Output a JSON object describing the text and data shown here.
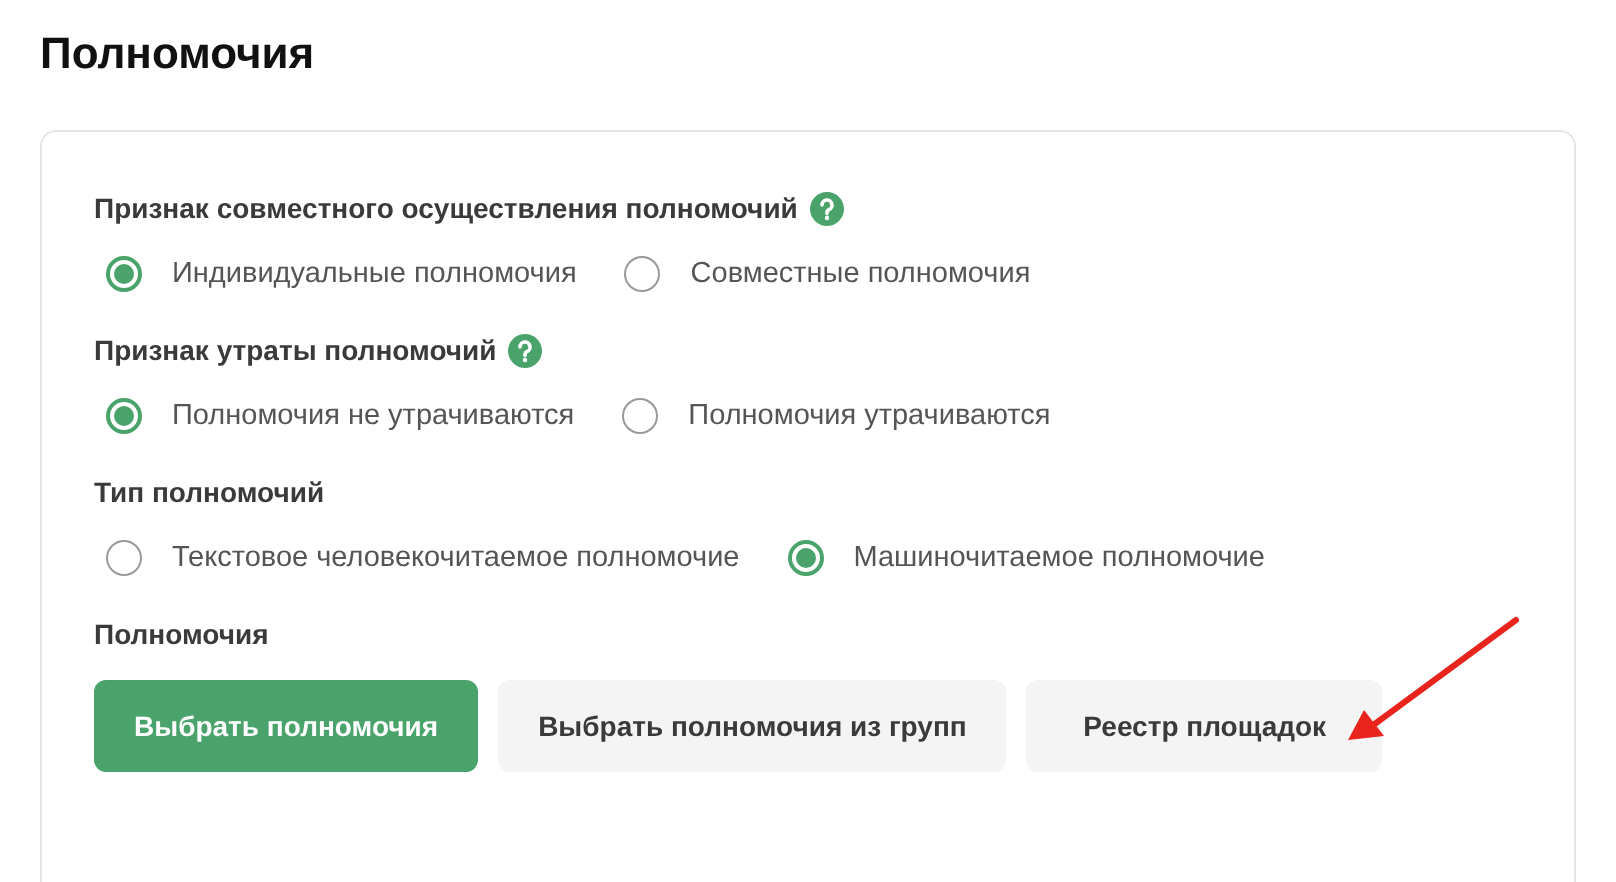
{
  "title": "Полномочия",
  "groups": [
    {
      "label": "Признак совместного осуществления полномочий",
      "help": true,
      "options": [
        {
          "label": "Индивидуальные полномочия",
          "selected": true
        },
        {
          "label": "Совместные полномочия",
          "selected": false
        }
      ]
    },
    {
      "label": "Признак утраты полномочий",
      "help": true,
      "options": [
        {
          "label": "Полномочия не утрачиваются",
          "selected": true
        },
        {
          "label": "Полномочия утрачиваются",
          "selected": false
        }
      ]
    },
    {
      "label": "Тип полномочий",
      "help": false,
      "options": [
        {
          "label": "Текстовое человекочитаемое полномочие",
          "selected": false
        },
        {
          "label": "Машиночитаемое полномочие",
          "selected": true
        }
      ]
    }
  ],
  "actions": {
    "label": "Полномочия",
    "buttons": [
      {
        "label": "Выбрать полномочия",
        "kind": "primary"
      },
      {
        "label": "Выбрать полномочия из групп",
        "kind": "secondary"
      },
      {
        "label": "Реестр площадок",
        "kind": "secondary"
      }
    ]
  }
}
